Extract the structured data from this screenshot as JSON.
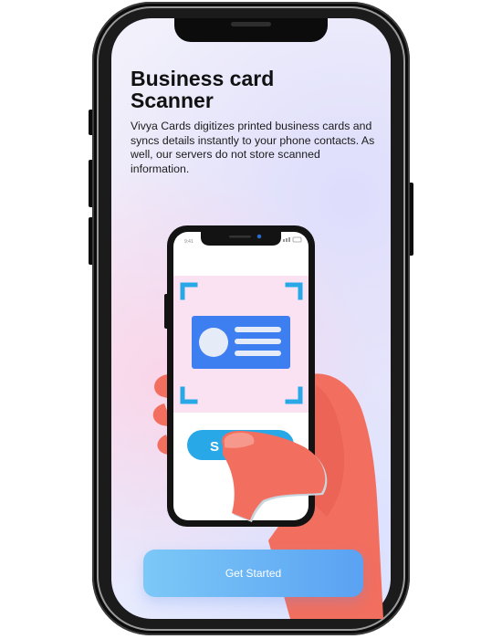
{
  "onboarding": {
    "title": "Business card Scanner",
    "description": "Vivya Cards digitizes printed business cards and syncs details instantly to your phone contacts. As well, our servers do not store scanned information."
  },
  "illustration": {
    "status_time": "9:41",
    "scan_button_label": "S"
  },
  "cta": {
    "label": "Get Started"
  },
  "colors": {
    "accent": "#29a8e8",
    "card": "#3d7ff0",
    "scan_bracket": "#29a8e8",
    "hand": "#f26f5f",
    "button_start": "#7cc8f7",
    "button_end": "#5aa2f3"
  }
}
